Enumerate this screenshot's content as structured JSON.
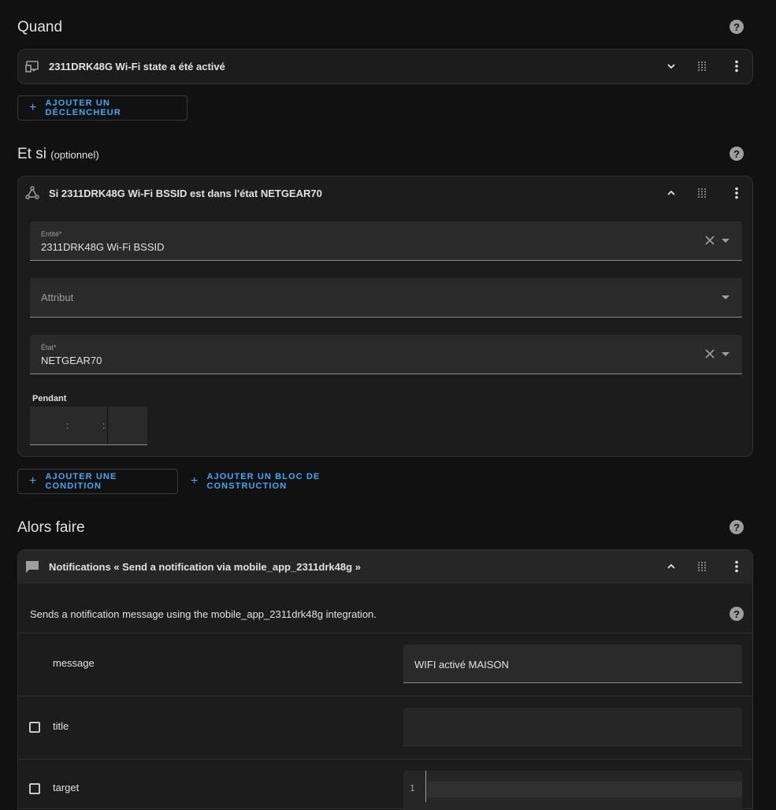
{
  "quand": {
    "title": "Quand",
    "trigger_card": {
      "title": "2311DRK48G Wi-Fi state a été activé"
    },
    "add_trigger_label": "AJOUTER UN DÉCLENCHEUR"
  },
  "et_si": {
    "title": "Et si",
    "optional_label": "(optionnel)",
    "condition_card": {
      "title": "Si 2311DRK48G Wi-Fi BSSID est dans l'état NETGEAR70",
      "entity_field": {
        "label": "Entité*",
        "value": "2311DRK48G Wi-Fi BSSID"
      },
      "attribute_field": {
        "placeholder": "Attribut"
      },
      "state_field": {
        "label": "État*",
        "value": "NETGEAR70"
      },
      "duration": {
        "label": "Pendant",
        "sep1": ":",
        "sep2": ":"
      }
    },
    "add_condition_label": "AJOUTER UNE CONDITION",
    "add_block_label": "AJOUTER UN BLOC DE CONSTRUCTION"
  },
  "alors_faire": {
    "title": "Alors faire",
    "action_card": {
      "title": "Notifications « Send a notification via mobile_app_2311drk48g »",
      "description": "Sends a notification message using the mobile_app_2311drk48g integration.",
      "fields": [
        {
          "name": "message",
          "value": "WIFI activé MAISON"
        },
        {
          "name": "title",
          "value": ""
        },
        {
          "name": "target",
          "line_number": "1"
        }
      ]
    }
  },
  "icons": {
    "help": "help-circle-icon",
    "expand": "chevron-down-icon",
    "collapse": "chevron-up-icon",
    "drag": "drag-handle-icon",
    "menu": "dots-vertical-icon",
    "device": "devices-icon",
    "state": "state-graph-icon",
    "notification": "message-icon"
  },
  "help_glyph": "?",
  "add_glyph": "+",
  "colors": {
    "accent": "#3fa9f5",
    "background": "#111111",
    "card": "#1c1c1c"
  }
}
